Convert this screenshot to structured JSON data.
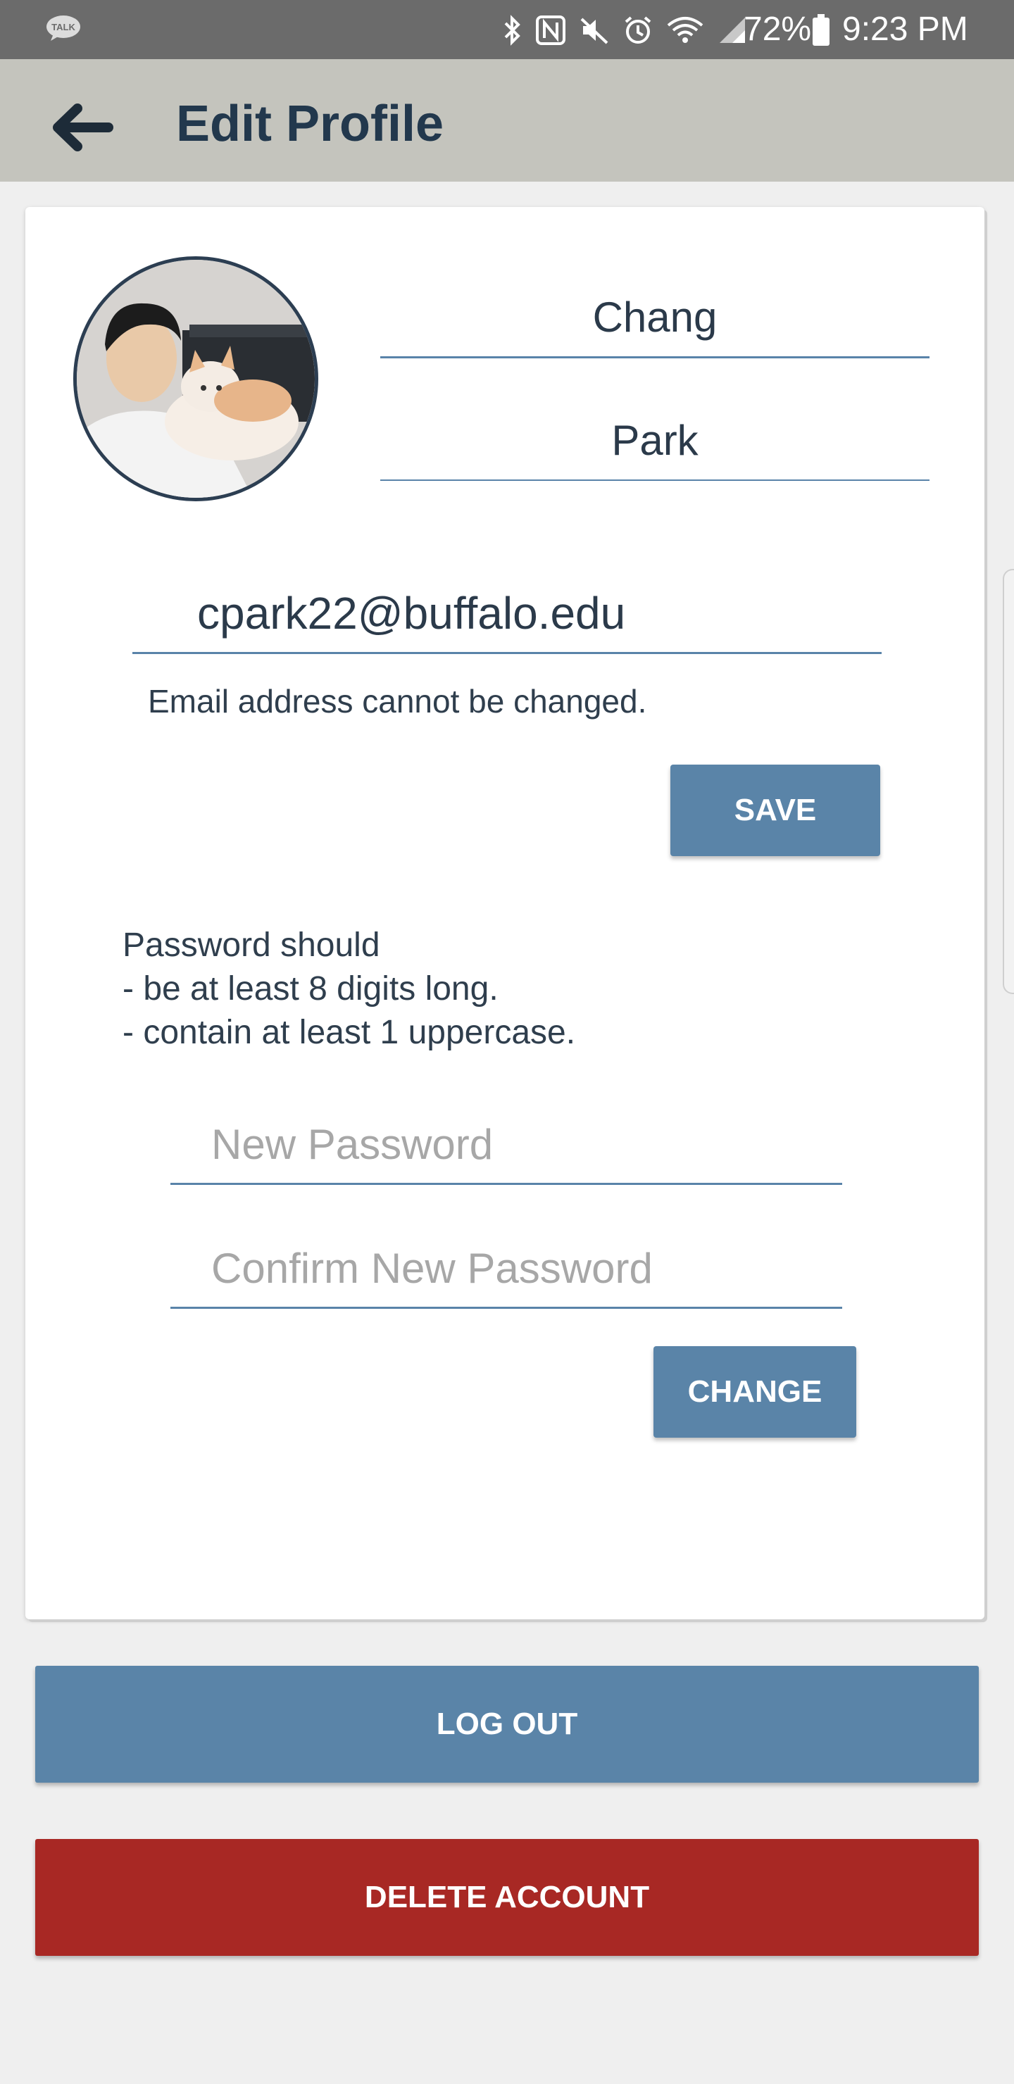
{
  "status_bar": {
    "app_badge": "TALK",
    "battery_percent": "72%",
    "time": "9:23 PM"
  },
  "header": {
    "title": "Edit Profile"
  },
  "profile": {
    "first_name": "Chang",
    "last_name": "Park",
    "email": "cpark22@buffalo.edu",
    "email_note": "Email address cannot be changed.",
    "save_label": "SAVE"
  },
  "password": {
    "rules": "Password should\n- be at least 8 digits long.\n- contain at least 1 uppercase.",
    "new_placeholder": "New Password",
    "confirm_placeholder": "Confirm New Password",
    "change_label": "CHANGE"
  },
  "actions": {
    "logout_label": "LOG OUT",
    "delete_label": "DELETE ACCOUNT"
  },
  "colors": {
    "primary": "#5a84a8",
    "danger": "#a82824",
    "app_bar": "#c4c4bd",
    "status_bar": "#6b6b6b"
  }
}
